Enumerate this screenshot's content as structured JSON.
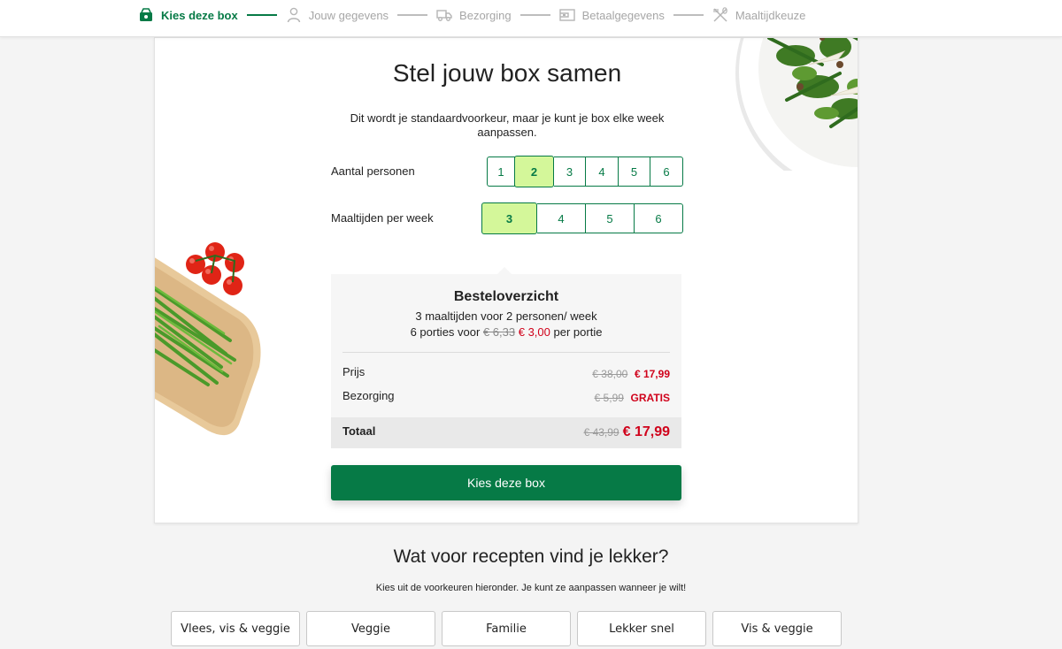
{
  "stepper": {
    "steps": [
      {
        "label": "Kies deze box",
        "icon": "box-icon",
        "active": true
      },
      {
        "label": "Jouw gegevens",
        "icon": "user-icon",
        "active": false
      },
      {
        "label": "Bezorging",
        "icon": "truck-icon",
        "active": false
      },
      {
        "label": "Betaalgegevens",
        "icon": "wallet-icon",
        "active": false
      },
      {
        "label": "Maaltijdkeuze",
        "icon": "utensils-icon",
        "active": false
      }
    ]
  },
  "box": {
    "title": "Stel jouw box samen",
    "subtitle": "Dit wordt je standaardvoorkeur, maar je kunt je box elke week aanpassen.",
    "persons": {
      "label": "Aantal personen",
      "options": [
        "1",
        "2",
        "3",
        "4",
        "5",
        "6"
      ],
      "selected": "2"
    },
    "meals": {
      "label": "Maaltijden per week",
      "options": [
        "3",
        "4",
        "5",
        "6"
      ],
      "selected": "3"
    }
  },
  "summary": {
    "title": "Besteloverzicht",
    "line1": "3 maaltijden voor 2 personen/ week",
    "line2_prefix": "6 porties voor",
    "line2_old": "€ 6,33",
    "line2_new": "€ 3,00",
    "line2_suffix": "per portie",
    "price_label": "Prijs",
    "price_old": "€ 38,00",
    "price_new": "€ 17,99",
    "delivery_label": "Bezorging",
    "delivery_old": "€ 5,99",
    "delivery_new": "GRATIS",
    "total_label": "Totaal",
    "total_old": "€ 43,99",
    "total_new": "€ 17,99"
  },
  "cta": {
    "label": "Kies deze box"
  },
  "preferences": {
    "title": "Wat voor recepten vind je lekker?",
    "subtitle": "Kies uit de voorkeuren hieronder. Je kunt ze aanpassen wanneer je wilt!",
    "options": [
      "Vlees, vis & veggie",
      "Veggie",
      "Familie",
      "Lekker snel",
      "Vis & veggie"
    ]
  },
  "colors": {
    "brand": "#067a46",
    "selected": "#d4f79a",
    "discount": "#d0021b"
  }
}
